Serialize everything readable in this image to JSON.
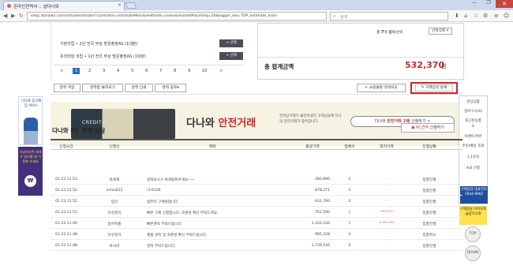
{
  "browser": {
    "tab_title": "온라인견적서 :: 샵다나와",
    "tab_close": "×",
    "url": "shop.danawa.com/virtualestimate/?controller=estimateMain&methods=index&marketPlaceSeq=16&logger_kw=TOP_estimate_main",
    "search_placeholder": "검색",
    "nav_back": "◀",
    "nav_forward": "▶",
    "nav_reload": "↻",
    "win_min": "—",
    "win_max": "❐",
    "win_close": "✕"
  },
  "packages": [
    {
      "text": "기본조립 • 2년 전국 무상 방문출장AS (1대분)",
      "button": "+ 선택"
    },
    {
      "text": "프리미엄 조립 • 1년 전국 무상 방문출장AS (1대분)",
      "button": "+ 선택"
    }
  ],
  "pagination": {
    "prev": "<",
    "pages": [
      "1",
      "2",
      "3",
      "4",
      "5",
      "6",
      "7",
      "8",
      "9",
      "10"
    ],
    "active": "1",
    "next": ">"
  },
  "summary": {
    "count_prefix": "총",
    "count": "7",
    "count_suffix": "개 품목선택",
    "select_delete": "선택삭제 ✕",
    "total_label": "총 합계금액",
    "total_value": "532,370",
    "total_unit": "원"
  },
  "toolbar": {
    "save": "견적 저장",
    "load": "견적함 불러오기",
    "print": "견적 인쇄",
    "share": "견적 공유▾",
    "compare": "쇼핑몰별 견적비교",
    "consult_register": "구매상담 등록"
  },
  "banner": {
    "card_text": "CREDIT",
    "logo_prefix": "다나와",
    "logo_accent": "안전거래",
    "desc": "전자상거래가 불안하셨던 고객님들께 다나와 안전거래가 찾아갑니다.",
    "cta_prefix": "다나와",
    "cta_accent": "안전거래 구매",
    "cta_suffix": "신청하기 >"
  },
  "left_ads": {
    "ad1": "다나와 중고매입 서비스",
    "ad2": "사업자라면 회계가 일러줄 때 이용해 보세요",
    "ad2_badge": "₩"
  },
  "right_side": {
    "items": [
      "관심상품",
      "장바구니(0)",
      "최근본상품",
      "0",
      "이벤트/쿠폰",
      "주문/배송 조회",
      "1:1문의",
      "A/S 신청"
    ],
    "ad1": "구매상담 대표번호 1644-8982",
    "ad2": "구매상담 카카오톡 @샵다나와",
    "top": "TOP",
    "down": "DOWN"
  },
  "consult": {
    "title": "다나와 PC 견적/상담",
    "button_prefix": "PC견적",
    "button_suffix": "신청하기",
    "headers": [
      "신청시간",
      "신청인",
      "제목",
      "평균가격",
      "업체수",
      "최저가격",
      "진행상황"
    ],
    "rows": [
      {
        "time": "01.23 11:53",
        "name": "박세계",
        "title": "견적보시구 싸게맞춰주세요~~",
        "avg": "280,890",
        "vendors": "0",
        "low": "-",
        "status": "입찰진행"
      },
      {
        "time": "01.23 11:52",
        "name": "nimis622",
        "title": "i3-6100",
        "avg": "878,271",
        "vendors": "0",
        "low": "-",
        "status": "입찰진행"
      },
      {
        "time": "01.23 11:52",
        "name": "임선",
        "title": "컴퓨터 구매원합니다",
        "avg": "631,700",
        "vendors": "0",
        "low": "-",
        "status": "입찰진행"
      },
      {
        "time": "01.23 11:51",
        "name": "유유있이",
        "title": "빠른 구매 신청합니다. 호환성 확인 부탁드려요.",
        "avg": "752,590",
        "vendors": "1",
        "low": "***,***",
        "status": "입찰진행"
      },
      {
        "time": "01.23 11:49",
        "name": "둥어목출",
        "title": "빠른견적 부탁드립니다.",
        "avg": "1,102,530",
        "vendors": "1",
        "low": "*,***,***",
        "status": "입찰진행"
      },
      {
        "time": "01.23 11:48",
        "name": "유유있이",
        "title": "제품 견적 및 호환성 확인 부탁드립니다.",
        "avg": "995,328",
        "vendors": "0",
        "low": "-",
        "status": "입찰취소"
      },
      {
        "time": "01.23 11:48",
        "name": "루사라",
        "title": "견적 부탁드립니다.",
        "avg": "1,739,146",
        "vendors": "0",
        "low": "-",
        "status": "입찰진행"
      }
    ]
  }
}
